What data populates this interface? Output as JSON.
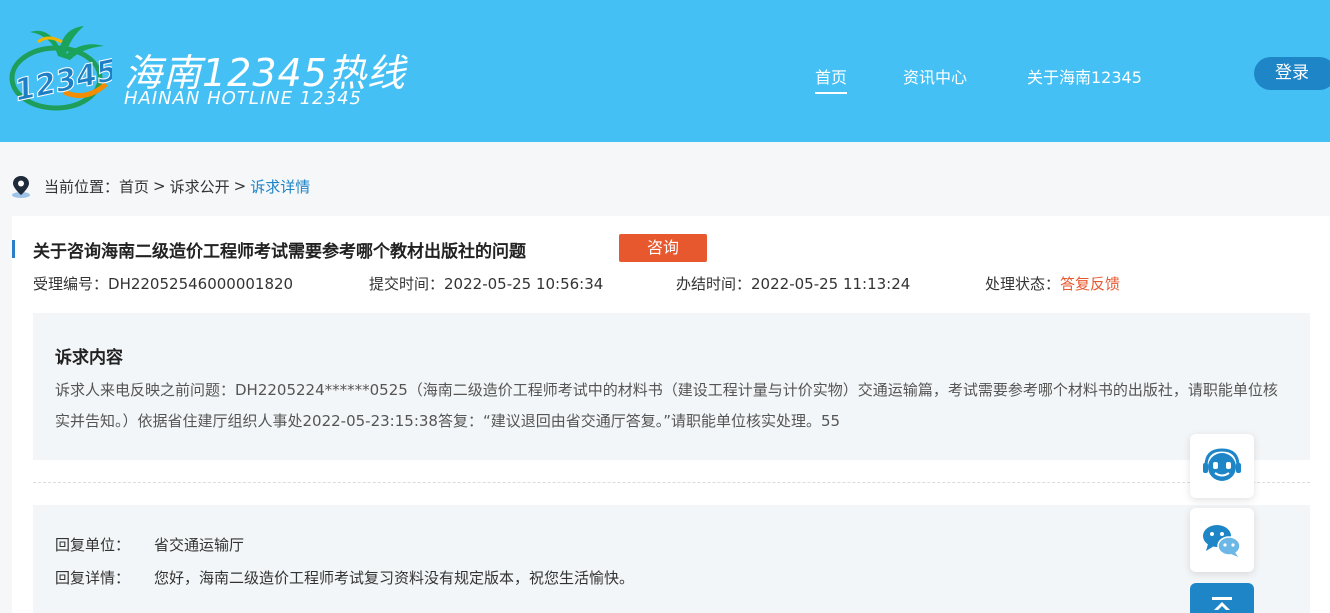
{
  "header": {
    "logo": {
      "badge_text": "12345",
      "title": "海南12345热线",
      "subtitle": "HAINAN HOTLINE 12345"
    },
    "nav": [
      {
        "label": "首页",
        "active": true
      },
      {
        "label": "资讯中心",
        "active": false
      },
      {
        "label": "关于海南12345",
        "active": false
      }
    ],
    "login_label": "登录",
    "colors": {
      "background": "#45c0f5",
      "login": "#1e85c7"
    }
  },
  "breadcrumb": {
    "prefix": "当前位置：",
    "items": [
      "首页",
      "诉求公开",
      "诉求详情"
    ],
    "separator": ">"
  },
  "case": {
    "title": "关于咨询海南二级造价工程师考试需要参考哪个教材出版社的问题",
    "type_badge": "咨询",
    "meta": {
      "id_label": "受理编号：",
      "id_value": "DH22052546000001820",
      "submit_label": "提交时间：",
      "submit_value": "2022-05-25 10:56:34",
      "finish_label": "办结时间：",
      "finish_value": "2022-05-25 11:13:24",
      "status_label": "处理状态：",
      "status_value": "答复反馈"
    },
    "content_heading": "诉求内容",
    "content_text": "诉求人来电反映之前问题：DH2205224******0525（海南二级造价工程师考试中的材料书（建设工程计量与计价实物）交通运输篇，考试需要参考哪个材料书的出版社，请职能单位核实并告知。）依据省住建厅组织人事处2022-05-23:15:38答复：“建议退回由省交通厅答复。”请职能单位核实处理。55",
    "reply": {
      "unit_label": "回复单位：",
      "unit_value": "省交通运输厅",
      "detail_label": "回复详情：",
      "detail_value": "您好，海南二级造价工程师考试复习资料没有规定版本，祝您生活愉快。"
    },
    "colors": {
      "accent": "#e8582e",
      "title_bar": "#2d7ec8"
    }
  },
  "floating": [
    {
      "icon": "customer-service-icon"
    },
    {
      "icon": "wechat-icon"
    },
    {
      "icon": "back-to-top-icon"
    }
  ]
}
